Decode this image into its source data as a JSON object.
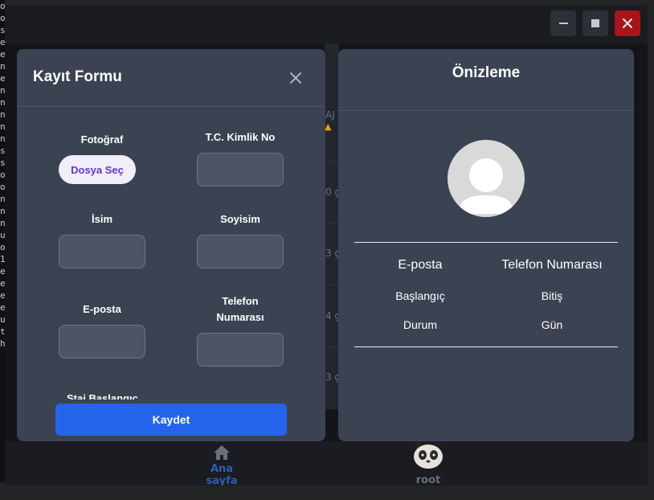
{
  "window": {
    "minimize_label": "–",
    "maximize_label": "■",
    "close_label": "✕"
  },
  "background": {
    "row_suffix_1": "0 g",
    "row_suffix_2": "3 g",
    "row_suffix_3": "4 g",
    "row_suffix_4": "3 g",
    "header_fragment": "AJ C"
  },
  "bottom_nav": {
    "home_label": "Ana sayfa",
    "root_label": "root"
  },
  "form": {
    "title": "Kayıt Formu",
    "photo_label": "Fotoğraf",
    "file_button": "Dosya Seç",
    "tc_label": "T.C. Kimlik No",
    "name_label": "İsim",
    "surname_label": "Soyisim",
    "email_label": "E-posta",
    "phone_label_line1": "Telefon",
    "phone_label_line2": "Numarası",
    "cut_label": "Staj Başlangıç",
    "save_button": "Kaydet"
  },
  "preview": {
    "title": "Önizleme",
    "email": "E-posta",
    "phone": "Telefon Numarası",
    "start": "Başlangıç",
    "end": "Bitiş",
    "status": "Durum",
    "day": "Gün"
  },
  "colors": {
    "modal_bg": "#3b4353",
    "save_button": "#2563eb",
    "file_button_text": "#6b35c9",
    "close_button": "#a7151b"
  }
}
